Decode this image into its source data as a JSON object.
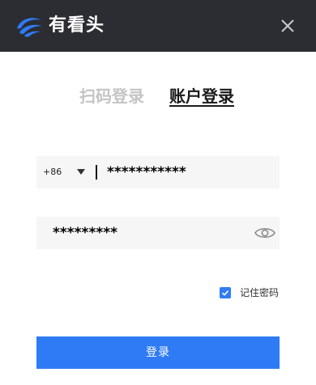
{
  "app": {
    "name": "有看头",
    "logo_icon": "wave-eye-logo-icon"
  },
  "titlebar": {
    "close_icon": "close-icon"
  },
  "tabs": [
    {
      "label": "扫码登录",
      "active": false
    },
    {
      "label": "账户登录",
      "active": true
    }
  ],
  "phone": {
    "country_code": "+86",
    "value": "***********"
  },
  "password": {
    "value": "*********",
    "toggle_icon": "eye-icon"
  },
  "remember": {
    "label": "记住密码",
    "checked": true
  },
  "login_button": {
    "label": "登录"
  },
  "colors": {
    "titlebar": "#2b2d33",
    "accent": "#2f7bf5",
    "field_bg": "#f6f6f7",
    "inactive_tab": "#c4c4c4"
  }
}
